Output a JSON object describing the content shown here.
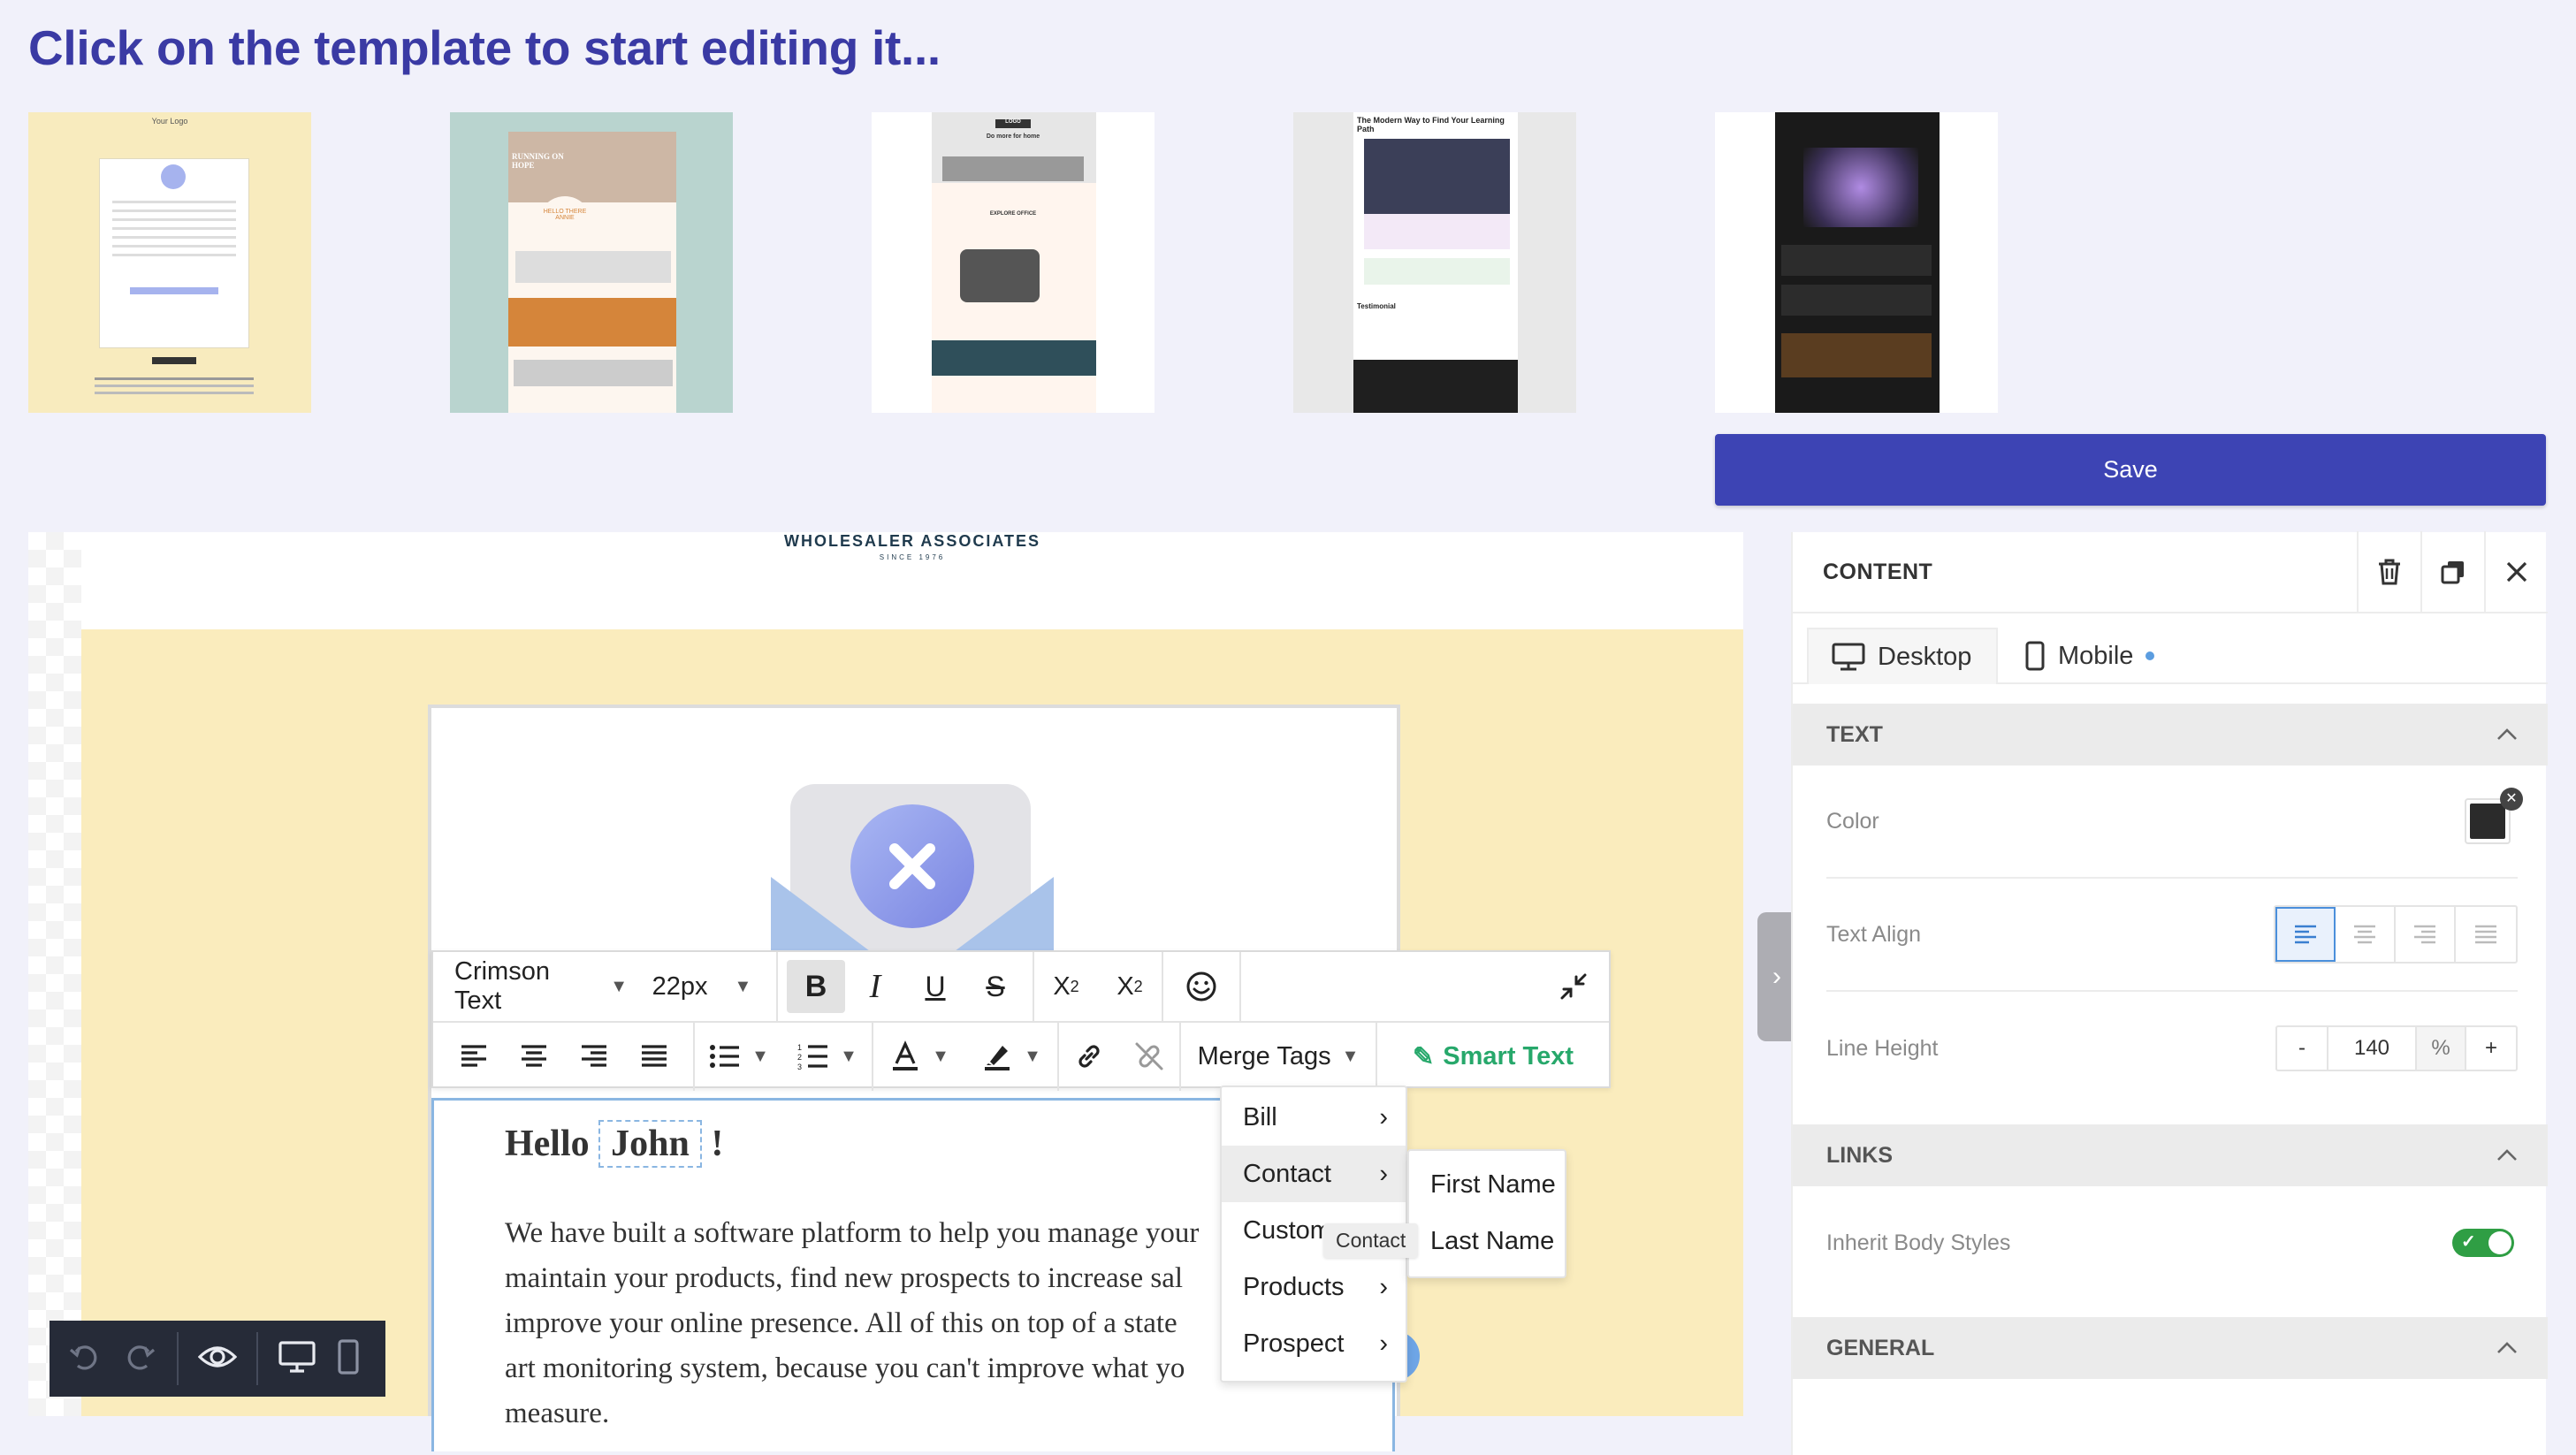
{
  "page": {
    "heading": "Click on the template to start editing it..."
  },
  "templates": {
    "t1": {
      "logo_text": "Your Logo"
    },
    "t2": {
      "banner_text": "RUNNING ON HOPE",
      "greeting": "HELLO THERE ANNIE"
    },
    "t3": {
      "logo_text": "LOGO",
      "tagline": "Do more for home",
      "section": "EXPLORE OFFICE"
    },
    "t4": {
      "title": "The Modern Way to Find Your Learning Path",
      "section": "Testimonial"
    },
    "t5": {}
  },
  "save": {
    "label": "Save"
  },
  "email": {
    "brand": "WHOLESALER ASSOCIATES",
    "brand_sub": "SINCE 1976",
    "greeting": "Hello",
    "merge_name": "John",
    "exclaim": "!",
    "paragraph_lines": [
      "We have built a software platform to help you manage your",
      "maintain your products, find new prospects to increase sal",
      "improve your online presence. All of this on top of a state",
      "art monitoring system, because you can't improve what yo",
      "measure."
    ]
  },
  "toolbar": {
    "font_family": "Crimson Text",
    "font_size": "22px",
    "bold": "B",
    "italic": "I",
    "underline": "U",
    "strike": "S",
    "merge_tags_label": "Merge Tags",
    "smart_text_label": "Smart Text"
  },
  "merge_menu": {
    "items": [
      {
        "label": "Bill"
      },
      {
        "label": "Contact"
      },
      {
        "label": "Custom"
      },
      {
        "label": "Products"
      },
      {
        "label": "Prospect"
      }
    ],
    "submenu": [
      {
        "label": "First Name"
      },
      {
        "label": "Last Name"
      }
    ],
    "tooltip": "Contact"
  },
  "panel": {
    "title": "CONTENT",
    "tabs": {
      "desktop": "Desktop",
      "mobile": "Mobile"
    },
    "text_section": "TEXT",
    "color_label": "Color",
    "color_value": "#2b2b2b",
    "text_align_label": "Text Align",
    "line_height_label": "Line Height",
    "line_height_minus": "-",
    "line_height_value": "140",
    "line_height_unit": "%",
    "line_height_plus": "+",
    "links_section": "LINKS",
    "inherit_label": "Inherit Body Styles",
    "inherit_on": true,
    "general_section": "GENERAL"
  },
  "colors": {
    "accent": "#3d44b4",
    "heading": "#3a3aa4",
    "smart_text": "#27a86b",
    "toggle_on": "#2f9e44",
    "email_bg": "#faecbd"
  }
}
